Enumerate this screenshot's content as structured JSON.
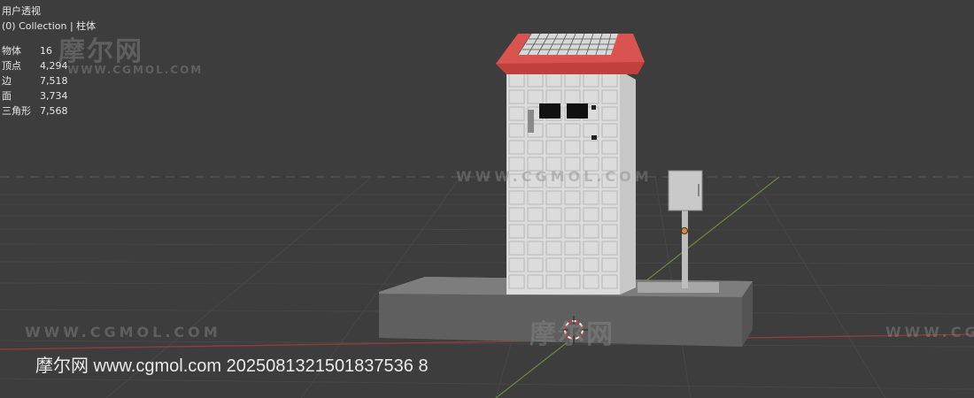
{
  "viewport": {
    "mode_title": "用户透视",
    "collection_label": "(0) Collection | 柱体"
  },
  "stats": [
    {
      "label": "物体",
      "value": "16"
    },
    {
      "label": "顶点",
      "value": "4,294"
    },
    {
      "label": "边",
      "value": "7,518"
    },
    {
      "label": "面",
      "value": "3,734"
    },
    {
      "label": "三角形",
      "value": "7,568"
    }
  ],
  "watermarks": {
    "cn": "摩尔网",
    "url": "WWW.CGMOL.COM"
  },
  "footer_text": "摩尔网 www.cgmol.com 2025081321501837536 8",
  "colors": {
    "background": "#3d3d3d",
    "roof": "#d9534f",
    "cabinet": "#e3e3e3",
    "base": "#6f6f6f"
  }
}
